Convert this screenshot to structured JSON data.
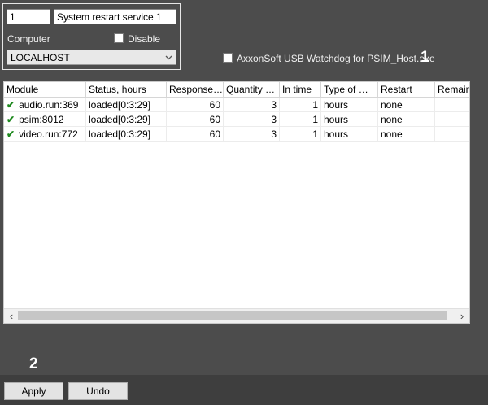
{
  "service": {
    "id_value": "1",
    "name_value": "System restart service 1",
    "computer_label": "Computer",
    "computer_value": "LOCALHOST",
    "disable_label": "Disable",
    "disable_checked": false
  },
  "watchdog": {
    "label": "AxxonSoft USB Watchdog for PSIM_Host.exe",
    "checked": false
  },
  "callouts": {
    "one": "1",
    "two": "2"
  },
  "table": {
    "columns": [
      "Module",
      "Status, hours",
      "Response…",
      "Quantity …",
      "In time",
      "Type of …",
      "Restart",
      "Remain"
    ],
    "rows": [
      {
        "module": "audio.run:369",
        "status": "loaded[0:3:29]",
        "response": "60",
        "quantity": "3",
        "in_time": "1",
        "type": "hours",
        "restart": "none",
        "remain": ""
      },
      {
        "module": "psim:8012",
        "status": "loaded[0:3:29]",
        "response": "60",
        "quantity": "3",
        "in_time": "1",
        "type": "hours",
        "restart": "none",
        "remain": ""
      },
      {
        "module": "video.run:772",
        "status": "loaded[0:3:29]",
        "response": "60",
        "quantity": "3",
        "in_time": "1",
        "type": "hours",
        "restart": "none",
        "remain": ""
      }
    ]
  },
  "scrollbar": {
    "left_arrow": "‹",
    "right_arrow": "›"
  },
  "buttons": {
    "apply": "Apply",
    "undo": "Undo"
  },
  "colors": {
    "background": "#4c4c4c",
    "bottom_bar": "#3e3e3e",
    "check_green": "#1f8a1f"
  }
}
